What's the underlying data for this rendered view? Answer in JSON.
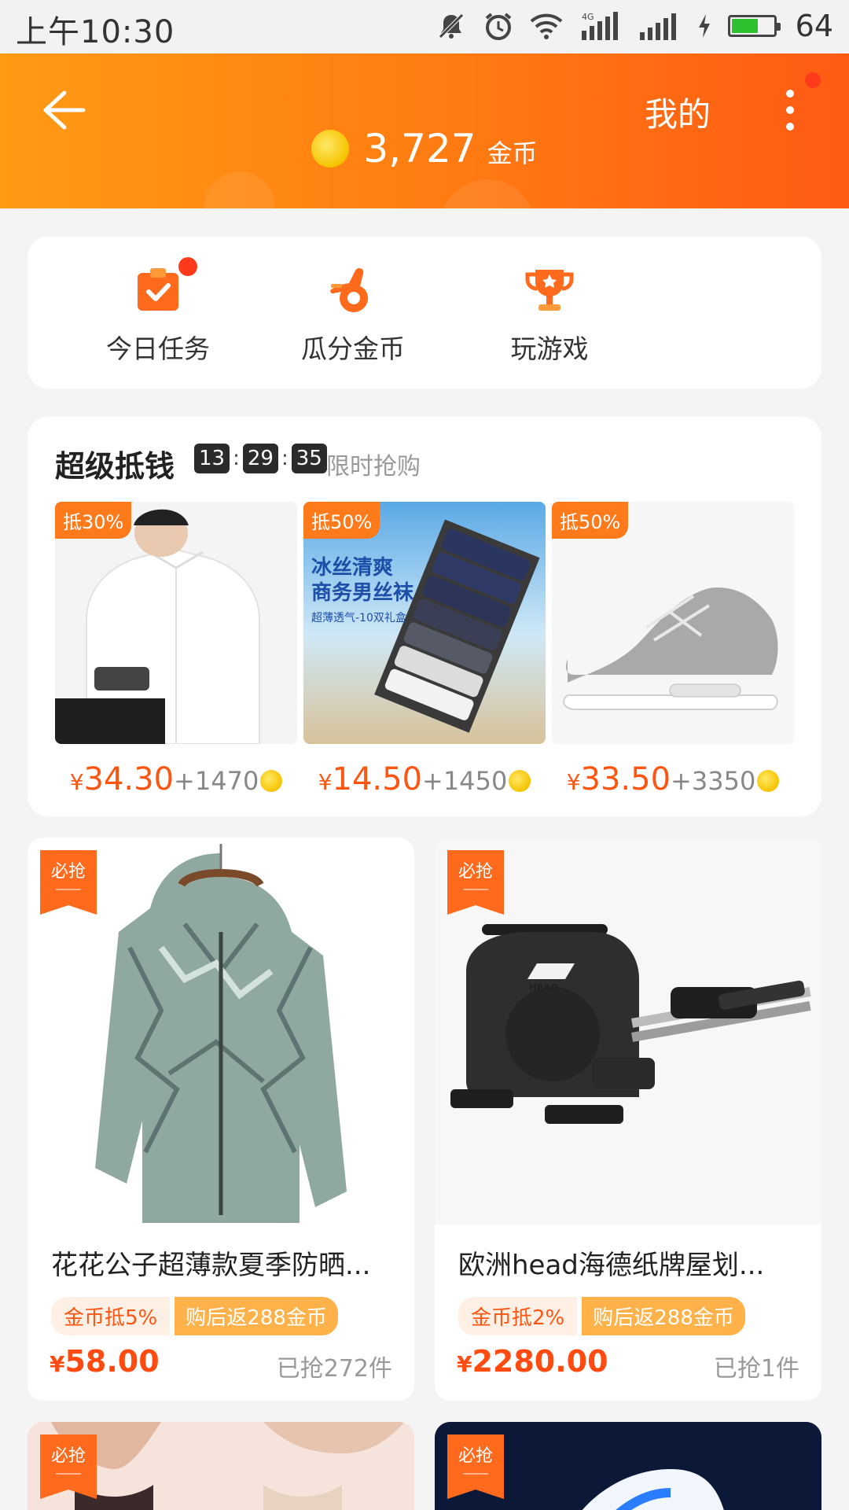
{
  "status_bar": {
    "time": "上午10:30",
    "battery_level": "64",
    "battery_fill_percent": 64,
    "network_label": "4G"
  },
  "header": {
    "mine_label": "我的",
    "coin_amount": "3,727",
    "coin_unit": "金币"
  },
  "menu": {
    "items": [
      {
        "label": "今日任务",
        "icon": "task-clipboard-icon"
      },
      {
        "label": "瓜分金币",
        "icon": "ok-hand-icon"
      },
      {
        "label": "玩游戏",
        "icon": "trophy-icon"
      }
    ]
  },
  "deal": {
    "title": "超级抵钱",
    "timer": [
      "13",
      "29",
      "35"
    ],
    "timer_sep": ":",
    "subtitle": "限时抢购",
    "items": [
      {
        "tag": "抵30%",
        "price": "34.30",
        "coins": "+1470",
        "image": "white-shirt"
      },
      {
        "tag": "抵50%",
        "price": "14.50",
        "coins": "+1450",
        "image": "socks-box",
        "img_text1": "冰丝清爽",
        "img_text2": "商务男丝袜",
        "img_text3": "超薄透气-10双礼盒"
      },
      {
        "tag": "抵50%",
        "price": "33.50",
        "coins": "+3350",
        "image": "grey-sneaker"
      }
    ],
    "currency": "¥"
  },
  "products": [
    {
      "badge": "必抢",
      "name": "花花公子超薄款夏季防晒...",
      "tag_discount": "金币抵5%",
      "tag_return": "购后返288金币",
      "price": "58.00",
      "sold": "已抢272件"
    },
    {
      "badge": "必抢",
      "name": "欧洲head海德纸牌屋划...",
      "tag_discount": "金币抵2%",
      "tag_return": "购后返288金币",
      "price": "2280.00",
      "sold": "已抢1件",
      "brand_mark": "HEAD"
    }
  ],
  "more_products": [
    {
      "badge": "必抢"
    },
    {
      "badge": "必抢"
    }
  ],
  "colors": {
    "accent": "#ff7a12",
    "price": "#ff5511",
    "badge_red": "#ff3b1c"
  }
}
